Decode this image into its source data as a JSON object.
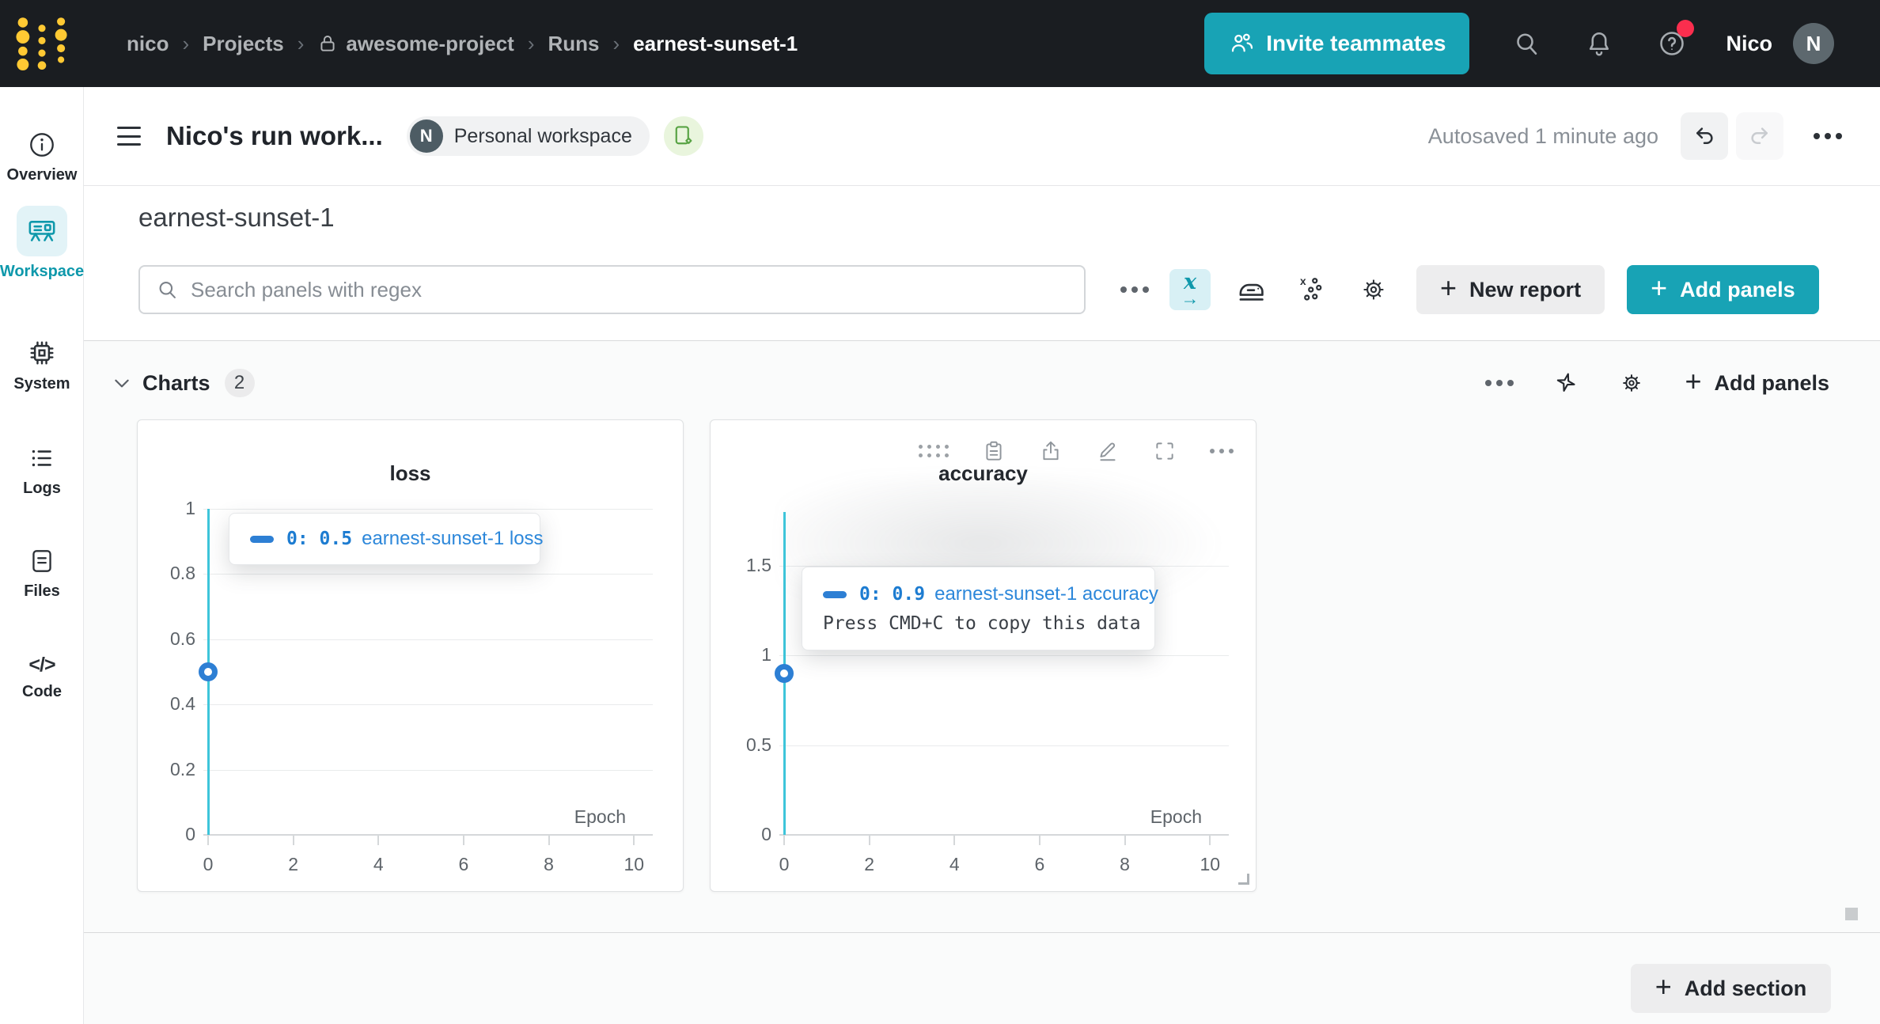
{
  "colors": {
    "teal": "#18a3b5",
    "gold": "#ffc933",
    "nav_bg": "#1a1d21",
    "chart_line": "#3ec5da",
    "point_blue": "#2d7fd4",
    "badge_red": "#fb2e4e",
    "workspace_teal": "#0e98ab"
  },
  "nav": {
    "breadcrumbs": [
      {
        "label": "nico"
      },
      {
        "label": "Projects"
      },
      {
        "label": "awesome-project"
      },
      {
        "label": "Runs"
      },
      {
        "label": "earnest-sunset-1"
      }
    ],
    "invite_label": "Invite teammates",
    "user_name": "Nico",
    "avatar_initial": "N"
  },
  "sidebar": {
    "items": [
      {
        "label": "Overview"
      },
      {
        "label": "Workspace"
      },
      {
        "label": "System"
      },
      {
        "label": "Logs"
      },
      {
        "label": "Files"
      },
      {
        "label": "Code"
      }
    ]
  },
  "header": {
    "title": "Nico's run work...",
    "badge_initial": "N",
    "workspace_badge": "Personal workspace",
    "autosaved": "Autosaved 1 minute ago"
  },
  "run": {
    "title": "earnest-sunset-1"
  },
  "search": {
    "placeholder": "Search panels with regex"
  },
  "toolbar": {
    "new_report": "New report",
    "add_panels": "Add panels"
  },
  "charts_section": {
    "title": "Charts",
    "count": "2",
    "add_panels": "Add panels",
    "add_section": "Add section"
  },
  "chart_data": [
    {
      "type": "line",
      "title": "loss",
      "series": [
        {
          "name": "earnest-sunset-1 loss",
          "x": [
            0
          ],
          "y": [
            0.5
          ],
          "color": "#2d7fd4"
        }
      ],
      "xlabel": "Epoch",
      "x_ticks": [
        0,
        2,
        4,
        6,
        8,
        10
      ],
      "y_ticks": [
        0,
        0.2,
        0.4,
        0.6,
        0.8,
        1
      ],
      "xlim": [
        0,
        10.33
      ],
      "ylim": [
        0,
        1
      ],
      "grid": true,
      "legend_position": "tooltip",
      "tooltip": {
        "step": "0: 0.5",
        "name": "earnest-sunset-1 loss"
      }
    },
    {
      "type": "line",
      "title": "accuracy",
      "series": [
        {
          "name": "earnest-sunset-1 accuracy",
          "x": [
            0
          ],
          "y": [
            0.9
          ],
          "color": "#2d7fd4"
        }
      ],
      "xlabel": "Epoch",
      "x_ticks": [
        0,
        2,
        4,
        6,
        8,
        10
      ],
      "y_ticks": [
        0,
        0.5,
        1,
        1.5
      ],
      "xlim": [
        0,
        10.33
      ],
      "ylim": [
        0,
        1.8
      ],
      "grid": true,
      "legend_position": "tooltip",
      "tooltip": {
        "step": "0: 0.9",
        "name": "earnest-sunset-1 accuracy",
        "hint": "Press CMD+C to copy this data"
      }
    }
  ]
}
